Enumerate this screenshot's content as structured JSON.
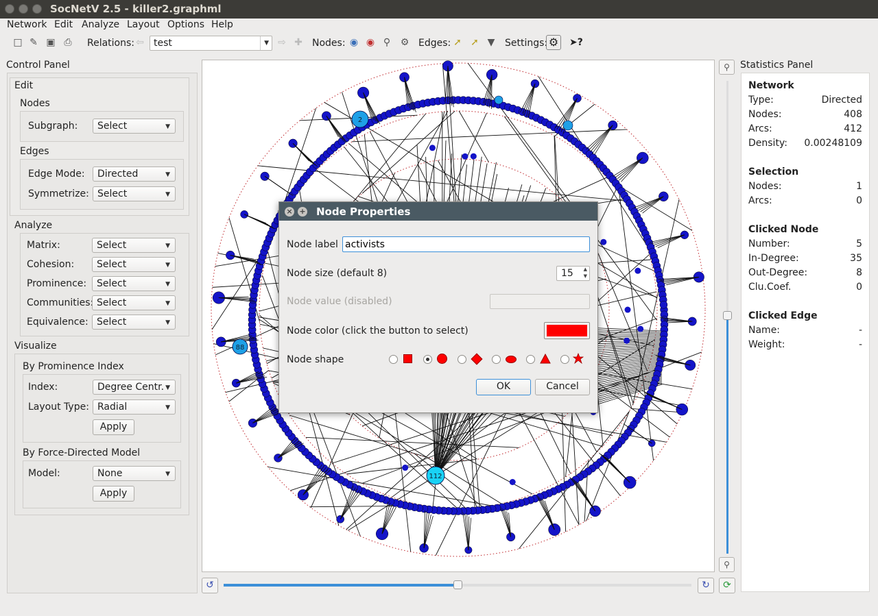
{
  "window": {
    "title": "SocNetV 2.5 - killer2.graphml"
  },
  "menu": [
    "Network",
    "Edit",
    "Analyze",
    "Layout",
    "Options",
    "Help"
  ],
  "toolbar": {
    "relations_label": "Relations:",
    "relation_value": "test",
    "nodes_label": "Nodes:",
    "edges_label": "Edges:",
    "settings_label": "Settings:"
  },
  "control_panel": {
    "title": "Control Panel",
    "edit_title": "Edit",
    "nodes_title": "Nodes",
    "subgraph_label": "Subgraph:",
    "subgraph_value": "Select",
    "edges_title": "Edges",
    "edge_mode_label": "Edge Mode:",
    "edge_mode_value": "Directed",
    "symmetrize_label": "Symmetrize:",
    "symmetrize_value": "Select",
    "analyze_title": "Analyze",
    "matrix_label": "Matrix:",
    "matrix_value": "Select",
    "cohesion_label": "Cohesion:",
    "cohesion_value": "Select",
    "prominence_label": "Prominence:",
    "prominence_value": "Select",
    "communities_label": "Communities:",
    "communities_value": "Select",
    "equivalence_label": "Equivalence:",
    "equivalence_value": "Select",
    "visualize_title": "Visualize",
    "by_prominence_title": "By Prominence Index",
    "index_label": "Index:",
    "index_value": "Degree Centr.",
    "layout_type_label": "Layout Type:",
    "layout_type_value": "Radial",
    "apply_label": "Apply",
    "by_force_title": "By Force-Directed Model",
    "model_label": "Model:",
    "model_value": "None",
    "apply2_label": "Apply"
  },
  "canvas": {
    "node_labels": [
      "2",
      "88",
      "112"
    ],
    "zoom_slider_fraction": 0.5,
    "rotate_slider_fraction": 0.5
  },
  "stats": {
    "title": "Statistics Panel",
    "network_title": "Network",
    "type_label": "Type:",
    "type_value": "Directed",
    "nodes_label": "Nodes:",
    "nodes_value": "408",
    "arcs_label": "Arcs:",
    "arcs_value": "412",
    "density_label": "Density:",
    "density_value": "0.00248109",
    "selection_title": "Selection",
    "sel_nodes_label": "Nodes:",
    "sel_nodes_value": "1",
    "sel_arcs_label": "Arcs:",
    "sel_arcs_value": "0",
    "clicked_node_title": "Clicked Node",
    "number_label": "Number:",
    "number_value": "5",
    "indegree_label": "In-Degree:",
    "indegree_value": "35",
    "outdegree_label": "Out-Degree:",
    "outdegree_value": "8",
    "clucoef_label": "Clu.Coef.",
    "clucoef_value": "0",
    "clicked_edge_title": "Clicked Edge",
    "name_label": "Name:",
    "name_value": "-",
    "weight_label": "Weight:",
    "weight_value": "-"
  },
  "dialog": {
    "title": "Node Properties",
    "label_label": "Node label",
    "label_value": "activists",
    "size_label": "Node size (default 8)",
    "size_value": "15",
    "value_label": "Node value (disabled)",
    "color_label": "Node color (click the button to select)",
    "color_value": "#ff0000",
    "shape_label": "Node shape",
    "shapes": [
      "box",
      "circle",
      "diamond",
      "ellipse",
      "triangle",
      "star"
    ],
    "selected_shape": "circle",
    "ok_label": "OK",
    "cancel_label": "Cancel"
  },
  "colors": {
    "node": "#1414c8",
    "node_highlight": "#1ea0e6",
    "accent": "#3c8fd8"
  }
}
